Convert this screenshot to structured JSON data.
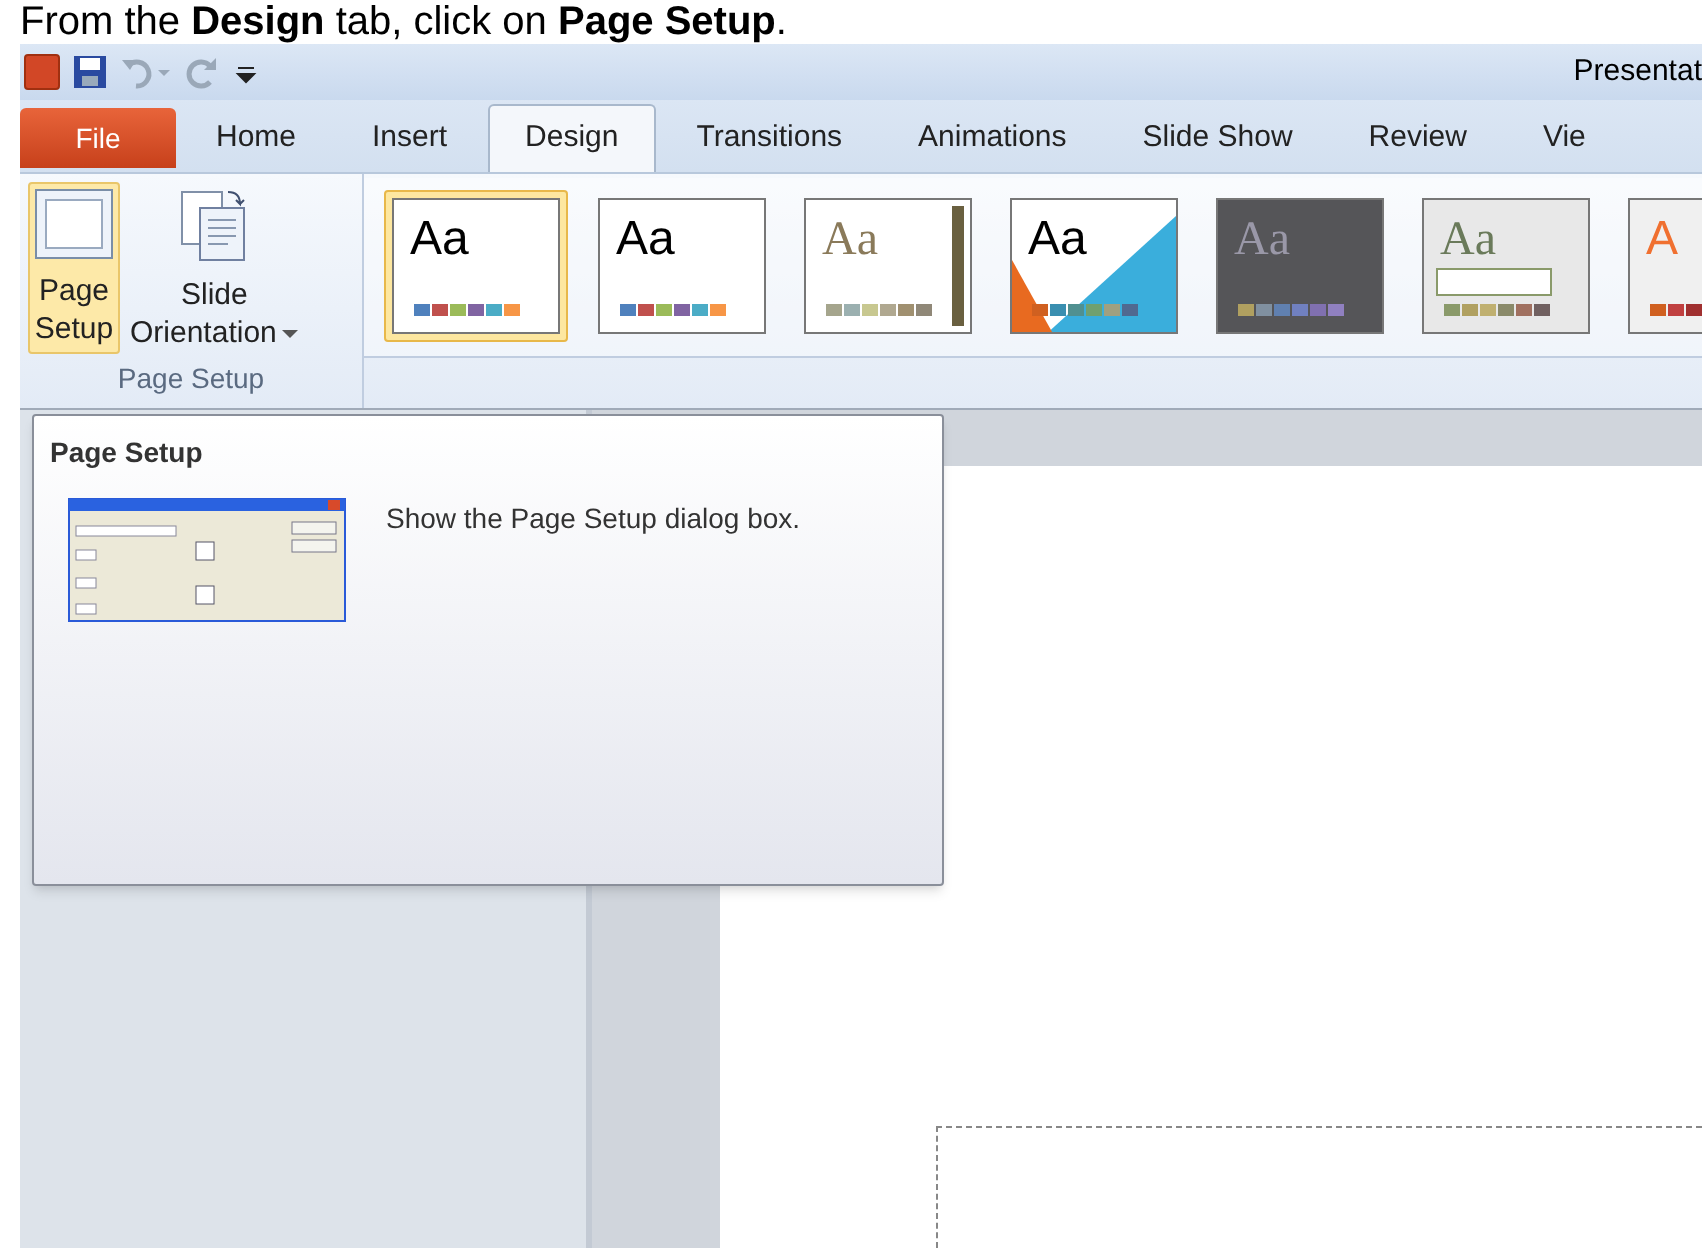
{
  "caption": "From the **Design** tab, click on **Page Setup**.",
  "window": {
    "title": "Presentat"
  },
  "tabs": [
    {
      "label": "File",
      "kind": "file",
      "selected": false
    },
    {
      "label": "Home",
      "kind": "tab",
      "selected": false
    },
    {
      "label": "Insert",
      "kind": "tab",
      "selected": false
    },
    {
      "label": "Design",
      "kind": "tab",
      "selected": true
    },
    {
      "label": "Transitions",
      "kind": "tab",
      "selected": false
    },
    {
      "label": "Animations",
      "kind": "tab",
      "selected": false
    },
    {
      "label": "Slide Show",
      "kind": "tab",
      "selected": false
    },
    {
      "label": "Review",
      "kind": "tab",
      "selected": false
    },
    {
      "label": "Vie",
      "kind": "tab",
      "selected": false
    }
  ],
  "ribbon_group": {
    "label": "Page Setup",
    "buttons": [
      {
        "lines": [
          "Page",
          "Setup"
        ],
        "kind": "page",
        "selected": true
      },
      {
        "lines": [
          "Slide",
          "Orientation"
        ],
        "kind": "orientation",
        "selected": false
      }
    ]
  },
  "themes": [
    {
      "label": "Aa",
      "kind": "office",
      "selected": true
    },
    {
      "label": "Aa",
      "kind": "plain",
      "selected": false
    },
    {
      "label": "Aa",
      "kind": "serif",
      "selected": false
    },
    {
      "label": "Aa",
      "kind": "angles",
      "selected": false
    },
    {
      "label": "Aa",
      "kind": "dark",
      "selected": false
    },
    {
      "label": "Aa",
      "kind": "boxed",
      "selected": false
    },
    {
      "label": "A",
      "kind": "cut",
      "selected": false
    }
  ],
  "tooltip": {
    "title": "Page Setup",
    "text": "Show the Page Setup dialog box."
  }
}
